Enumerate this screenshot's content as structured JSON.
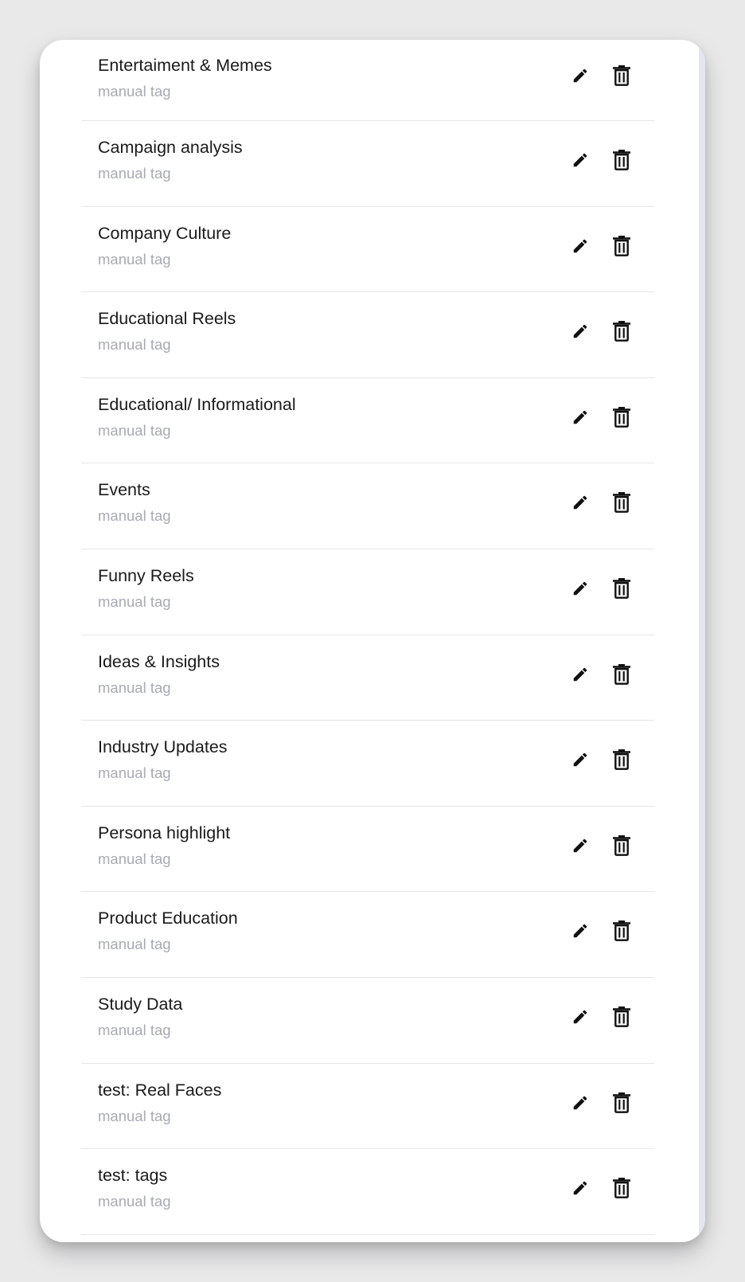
{
  "tags": [
    {
      "name": "Entertaiment & Memes",
      "type": "manual tag"
    },
    {
      "name": "Campaign analysis",
      "type": "manual tag"
    },
    {
      "name": "Company Culture",
      "type": "manual tag"
    },
    {
      "name": "Educational Reels",
      "type": "manual tag"
    },
    {
      "name": "Educational/ Informational",
      "type": "manual tag"
    },
    {
      "name": "Events",
      "type": "manual tag"
    },
    {
      "name": "Funny Reels",
      "type": "manual tag"
    },
    {
      "name": "Ideas & Insights",
      "type": "manual tag"
    },
    {
      "name": "Industry Updates",
      "type": "manual tag"
    },
    {
      "name": "Persona highlight",
      "type": "manual tag"
    },
    {
      "name": "Product Education",
      "type": "manual tag"
    },
    {
      "name": "Study Data",
      "type": "manual tag"
    },
    {
      "name": "test: Real Faces",
      "type": "manual tag"
    },
    {
      "name": "test: tags",
      "type": "manual tag"
    }
  ],
  "icons": {
    "edit": "pencil-icon",
    "delete": "trash-icon"
  },
  "colors": {
    "background": "#e9e9ea",
    "card": "#ffffff",
    "text": "#1a1a1a",
    "muted": "#a8abb2",
    "divider": "#e6e6e6",
    "icon": "#111111"
  }
}
